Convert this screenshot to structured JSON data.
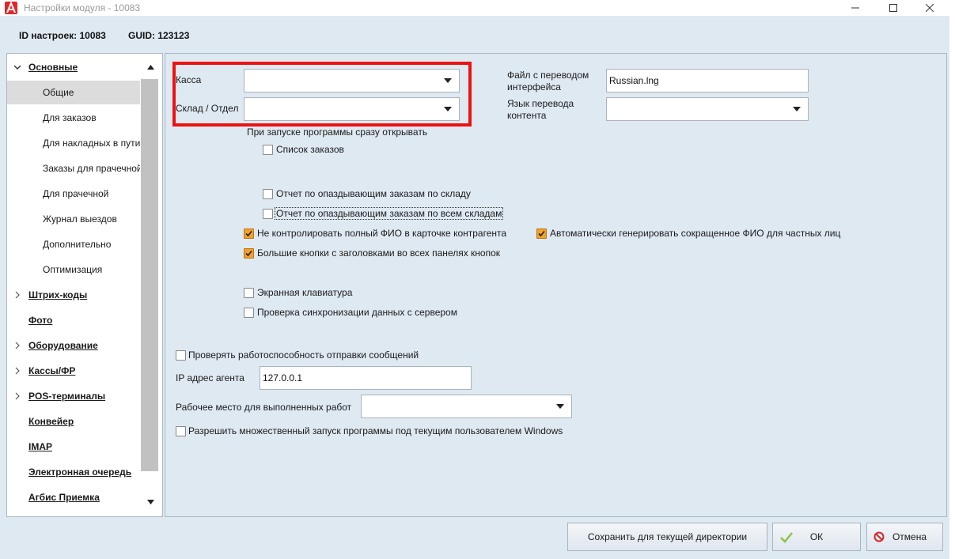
{
  "window": {
    "title": "Настройки модуля  - 10083",
    "minimize_icon": "minimize-icon",
    "maximize_icon": "maximize-icon",
    "close_icon": "close-icon"
  },
  "info": {
    "settings_id": "ID настроек: 10083",
    "guid": "GUID: 123123"
  },
  "nav": {
    "items": [
      {
        "label": "Основные",
        "type": "group",
        "expanded": true
      },
      {
        "label": "Общие",
        "type": "child",
        "selected": true
      },
      {
        "label": "Для заказов",
        "type": "child"
      },
      {
        "label": "Для накладных в пути",
        "type": "child"
      },
      {
        "label": "Заказы для прачечной",
        "type": "child"
      },
      {
        "label": "Для прачечной",
        "type": "child"
      },
      {
        "label": "Журнал выездов",
        "type": "child"
      },
      {
        "label": "Дополнительно",
        "type": "child"
      },
      {
        "label": "Оптимизация",
        "type": "child"
      },
      {
        "label": "Штрих-коды",
        "type": "group",
        "expandable": true
      },
      {
        "label": "Фото",
        "type": "group"
      },
      {
        "label": "Оборудование",
        "type": "group",
        "expandable": true
      },
      {
        "label": "Кассы/ФР",
        "type": "group",
        "expandable": true
      },
      {
        "label": "POS-терминалы",
        "type": "group",
        "expandable": true
      },
      {
        "label": "Конвейер",
        "type": "group"
      },
      {
        "label": "IMAP",
        "type": "group"
      },
      {
        "label": "Электронная очередь",
        "type": "group"
      },
      {
        "label": "Агбис Приемка",
        "type": "group"
      }
    ]
  },
  "form": {
    "kassa_label": "Касса",
    "kassa_value": "",
    "sklad_label": "Склад / Отдел",
    "sklad_value": "",
    "translation_file_label_1": "Файл с переводом",
    "translation_file_label_2": "интерфейса",
    "translation_file_value": "Russian.lng",
    "content_lang_label_1": "Язык перевода",
    "content_lang_label_2": "контента",
    "content_lang_value": "",
    "startup_open_label": "При запуске программы сразу открывать",
    "checkboxes": {
      "orders_list": {
        "label": "Список заказов",
        "checked": false
      },
      "late_report_warehouse": {
        "label": "Отчет по опаздывающим заказам по складу",
        "checked": false
      },
      "late_report_all": {
        "label": "Отчет по опаздывающим заказам по всем складам",
        "checked": false
      },
      "no_full_fio": {
        "label": "Не контролировать полный ФИО в карточке контрагента",
        "checked": true
      },
      "auto_short_fio": {
        "label": "Автоматически генерировать сокращенное ФИО для частных лиц",
        "checked": true
      },
      "big_buttons": {
        "label": "Большие кнопки с заголовками во всех панелях кнопок",
        "checked": true
      },
      "screen_keyboard": {
        "label": "Экранная клавиатура",
        "checked": false
      },
      "sync_check": {
        "label": "Проверка синхронизации данных с сервером",
        "checked": false
      },
      "msg_check": {
        "label": "Проверять работоспособность отправки сообщений",
        "checked": false
      },
      "multi_launch": {
        "label": "Разрешить множественный запуск программы под текущим пользователем Windows",
        "checked": false
      }
    },
    "ip_agent_label": "IP адрес агента",
    "ip_agent_value": "127.0.0.1",
    "workplace_label": "Рабочее место для выполненных работ",
    "workplace_value": ""
  },
  "buttons": {
    "save_dir": "Сохранить для текущей директории",
    "ok": "ОК",
    "cancel": "Отмена"
  },
  "colors": {
    "highlight": "#ee1111",
    "checkbox_checked": "#f3a12a",
    "background": "#dfe9f2"
  }
}
